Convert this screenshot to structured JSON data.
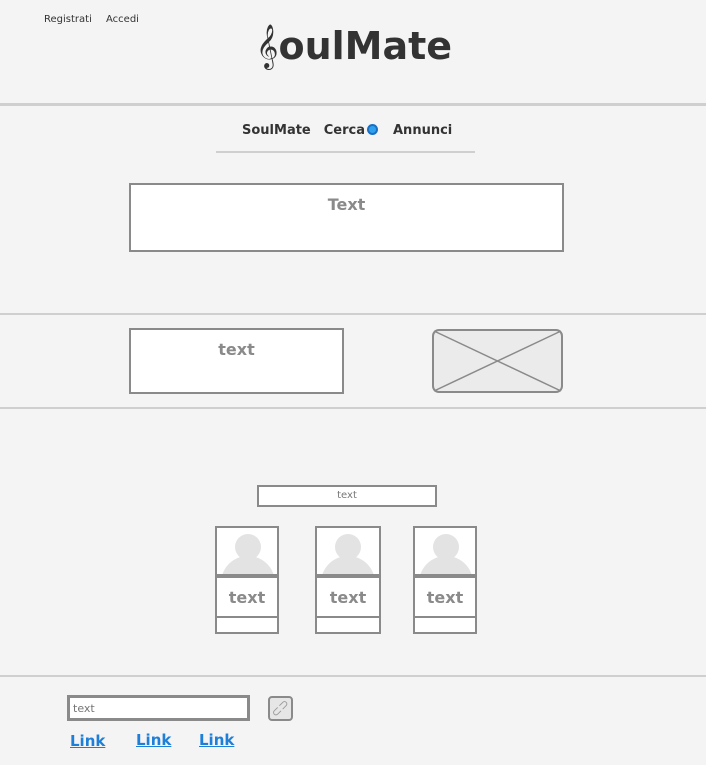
{
  "header": {
    "register": "Registrati",
    "login": "Accedi",
    "logo_clef": "𝄞",
    "logo_text": "oulMate"
  },
  "nav": {
    "items": [
      {
        "label": "SoulMate"
      },
      {
        "label": "Cerca"
      },
      {
        "label": "Annunci"
      }
    ],
    "search_icon": "magnifier-icon"
  },
  "hero": {
    "text": "Text"
  },
  "section2": {
    "text": "text",
    "image": "image-placeholder"
  },
  "section3": {
    "caption": "text",
    "cards": [
      {
        "text": "text"
      },
      {
        "text": "text"
      },
      {
        "text": "text"
      }
    ]
  },
  "footer": {
    "input_placeholder": "text",
    "link_button_icon": "link-icon",
    "links": [
      "Link",
      "Link",
      "Link"
    ]
  },
  "colors": {
    "link": "#1e7fd8",
    "border": "#8a8a8a",
    "background": "#f4f4f4"
  }
}
